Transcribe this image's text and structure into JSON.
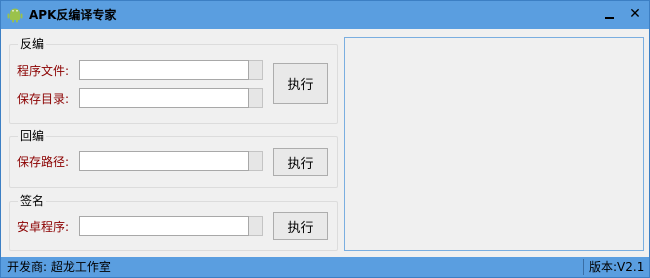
{
  "window": {
    "title": "APK反编译专家",
    "minimize_glyph": "",
    "close_glyph": "✕"
  },
  "decompile": {
    "group_title": "反编",
    "program_file_label": "程序文件:",
    "program_file_value": "",
    "save_dir_label": "保存目录:",
    "save_dir_value": "",
    "run_label": "执行"
  },
  "recompile": {
    "group_title": "回编",
    "save_path_label": "保存路径:",
    "save_path_value": "",
    "run_label": "执行"
  },
  "sign": {
    "group_title": "签名",
    "apk_label": "安卓程序:",
    "apk_value": "",
    "run_label": "执行"
  },
  "output": {
    "text": ""
  },
  "status": {
    "developer": "开发商: 超龙工作室",
    "version": "版本:V2.1"
  },
  "colors": {
    "titlebar": "#5a9ee0",
    "label": "#8b0000",
    "background": "#f0f0f0"
  },
  "icons": {
    "app": "android-icon"
  }
}
